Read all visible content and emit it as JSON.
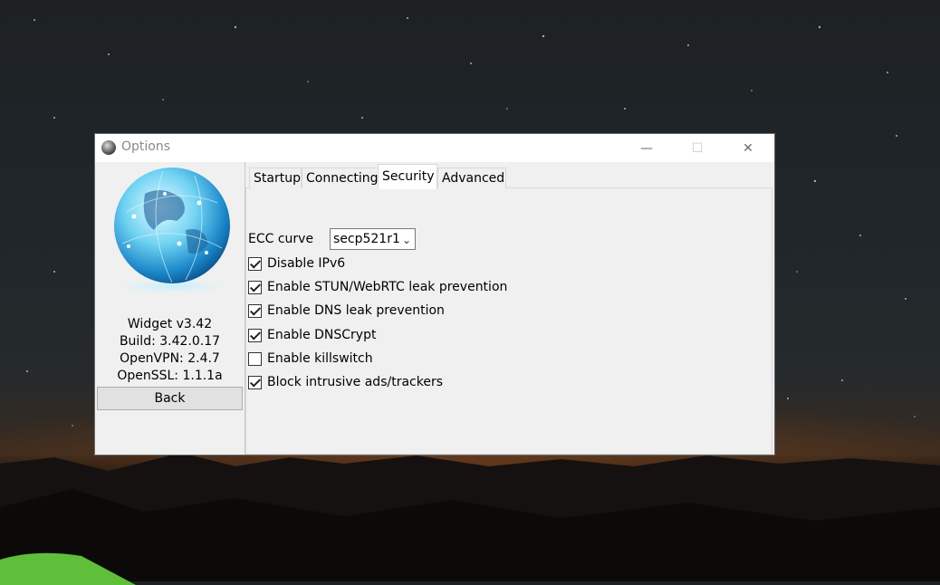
{
  "window": {
    "title": "Options"
  },
  "titlebar_buttons": {
    "minimize": "—",
    "maximize": "☐",
    "close": "✕"
  },
  "info": {
    "version": "Widget v3.42",
    "build": "Build: 3.42.0.17",
    "openvpn": "OpenVPN: 2.4.7",
    "openssl": "OpenSSL: 1.1.1a"
  },
  "back_label": "Back",
  "tabs": [
    {
      "label": "Startup"
    },
    {
      "label": "Connecting"
    },
    {
      "label": "Security",
      "active": true
    },
    {
      "label": "Advanced"
    }
  ],
  "security": {
    "ecc_label": "ECC curve",
    "ecc_value": "secp521r1",
    "options": [
      {
        "label": "Disable IPv6",
        "checked": true
      },
      {
        "label": "Enable STUN/WebRTC leak prevention",
        "checked": true
      },
      {
        "label": "Enable DNS leak prevention",
        "checked": true
      },
      {
        "label": "Enable DNSCrypt",
        "checked": true
      },
      {
        "label": "Enable killswitch",
        "checked": false
      },
      {
        "label": "Block intrusive ads/trackers",
        "checked": true
      }
    ]
  },
  "icons": {
    "app": "globe-icon",
    "dropdown": "chevron-down-icon"
  }
}
